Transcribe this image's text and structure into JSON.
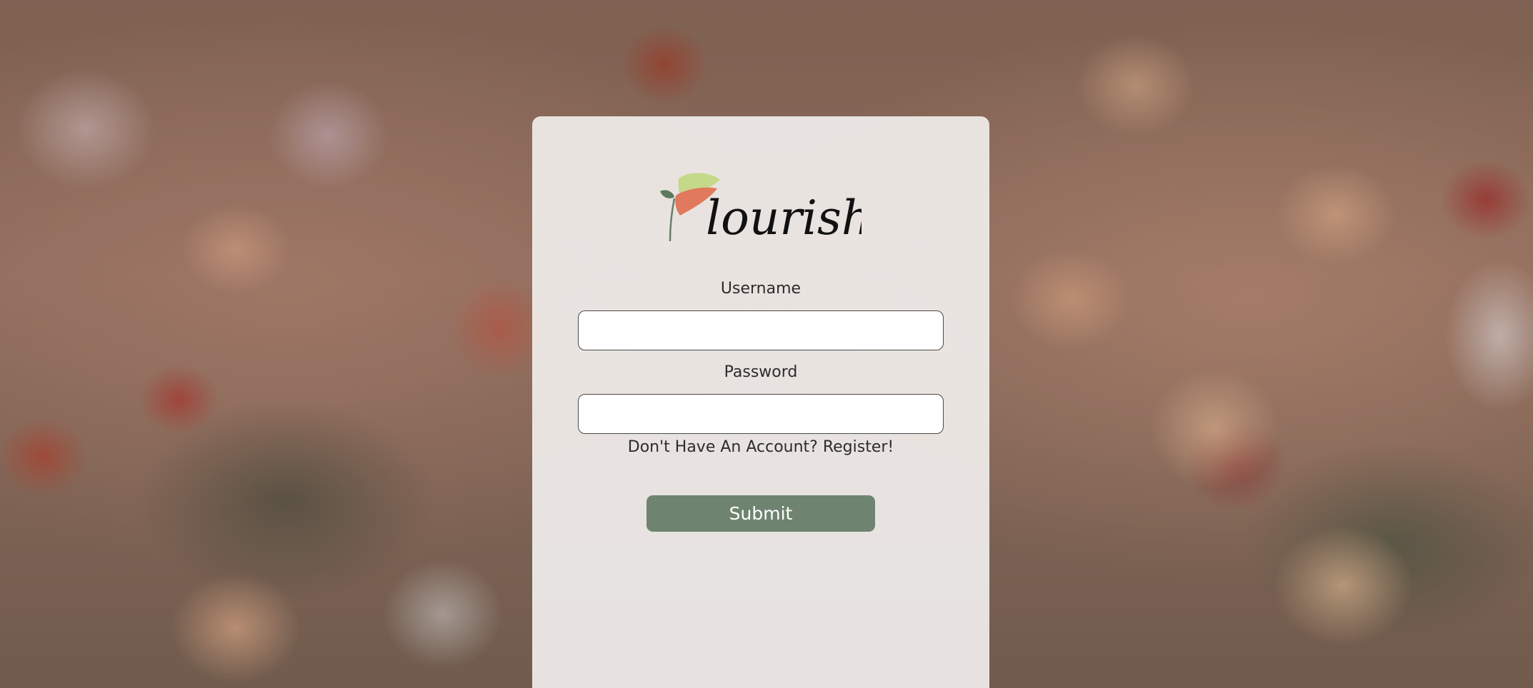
{
  "app": {
    "logo_text": "lourish",
    "logo_name": "Flourish"
  },
  "form": {
    "username_label": "Username",
    "username_value": "",
    "password_label": "Password",
    "password_value": "",
    "register_link": "Don't Have An Account? Register!",
    "submit_label": "Submit"
  },
  "colors": {
    "submit_bg": "#6e8470",
    "card_bg": "#f0edeb",
    "text": "#2c2c2c"
  }
}
